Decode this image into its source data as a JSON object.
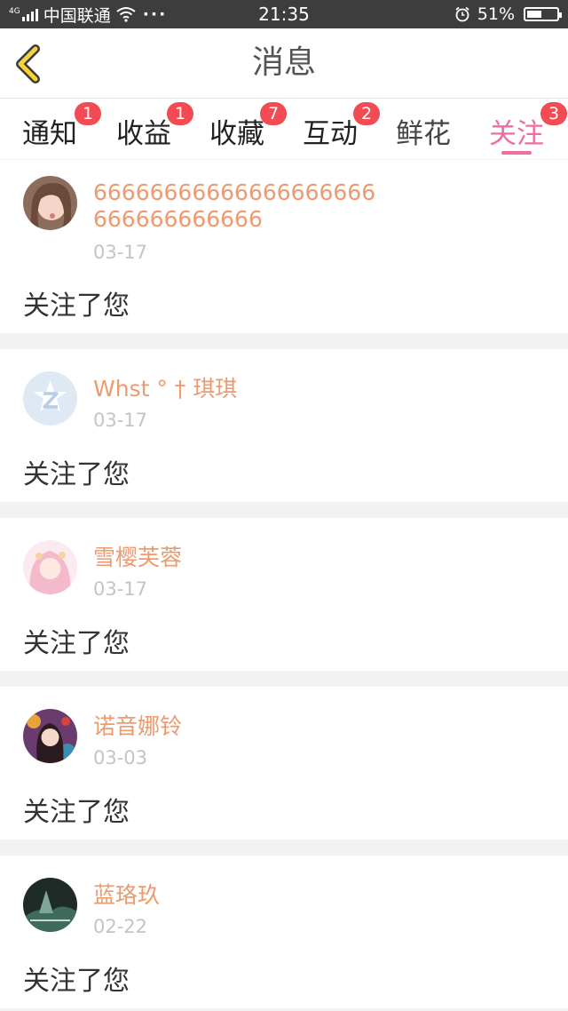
{
  "status_bar": {
    "network_type": "4G",
    "carrier": "中国联通",
    "more": "···",
    "time": "21:35",
    "battery_percent": "51%",
    "battery_level": 0.51
  },
  "header": {
    "title": "消息"
  },
  "tabs": [
    {
      "label": "通知",
      "badge": "1"
    },
    {
      "label": "收益",
      "badge": "1"
    },
    {
      "label": "收藏",
      "badge": "7"
    },
    {
      "label": "互动",
      "badge": "2"
    },
    {
      "label": "鲜花",
      "badge": ""
    },
    {
      "label": "关注",
      "badge": "3",
      "active": true
    }
  ],
  "notifications": [
    {
      "username": "66666666666666666666666666666666",
      "date": "03-17",
      "message": "关注了您"
    },
    {
      "username": "Whst ° † 琪琪",
      "date": "03-17",
      "message": "关注了您"
    },
    {
      "username": "雪樱芙蓉",
      "date": "03-17",
      "message": "关注了您"
    },
    {
      "username": "诺音娜铃",
      "date": "03-03",
      "message": "关注了您"
    },
    {
      "username": "蓝珞玖",
      "date": "02-22",
      "message": "关注了您"
    }
  ],
  "colors": {
    "accent_pink": "#ee6ea1",
    "username_orange": "#ee9a6e",
    "badge_red": "#f24b53",
    "back_arrow_yellow": "#f5d23a"
  }
}
